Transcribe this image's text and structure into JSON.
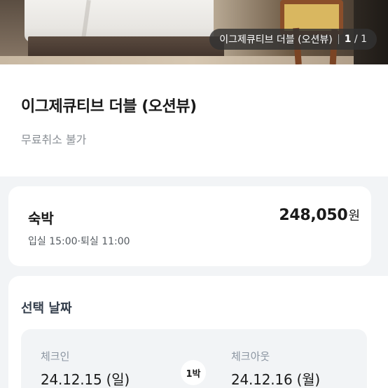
{
  "photo": {
    "caption": "이그제큐티브 더블 (오션뷰)",
    "current_index": "1",
    "total_label": "/ 1"
  },
  "room": {
    "name": "이그제큐티브 더블 (오션뷰)",
    "cancellation_policy": "무료취소 불가"
  },
  "stay": {
    "label": "숙박",
    "price": "248,050",
    "currency_unit": "원",
    "check_times": "입실 15:00·퇴실 11:00"
  },
  "dates": {
    "heading": "선택 날짜",
    "checkin_label": "체크인",
    "checkin_date": "24.12.15 (일)",
    "checkout_label": "체크아웃",
    "checkout_date": "24.12.16 (월)",
    "nights": "1박"
  }
}
